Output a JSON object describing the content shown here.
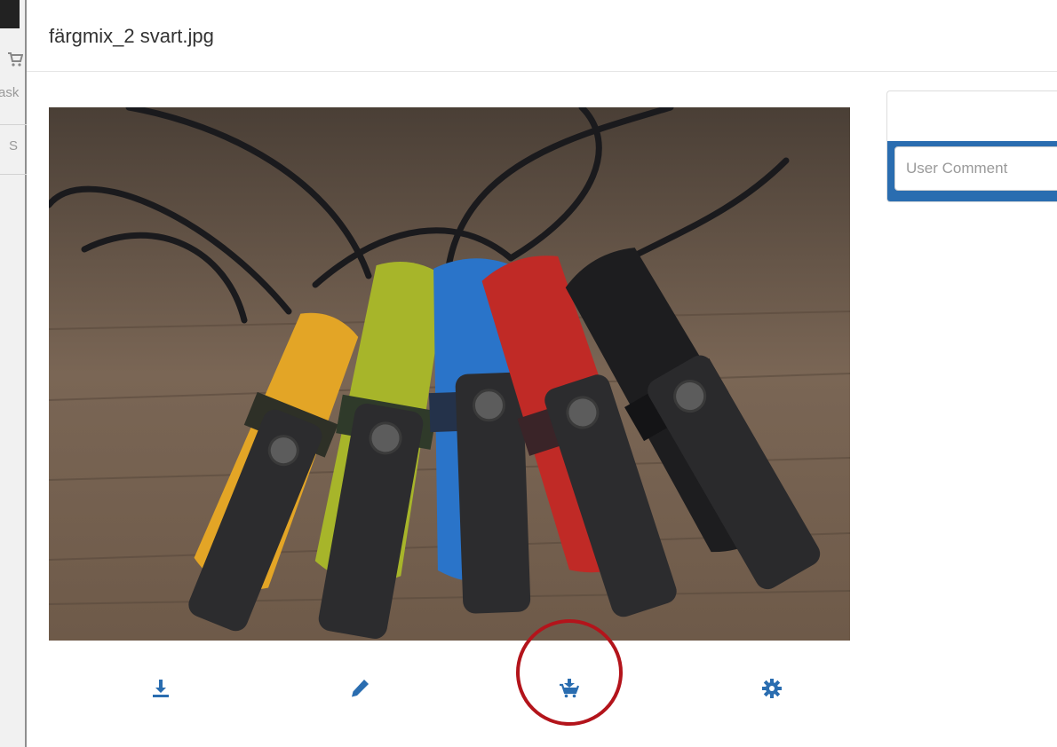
{
  "background_app": {
    "cut_text_1": "ask",
    "cut_text_2": "S"
  },
  "modal": {
    "title": "färgmix_2 svart.jpg"
  },
  "image": {
    "description_name": "knife-photo",
    "sheath_colors": [
      "#e3a526",
      "#a7b52a",
      "#2a74c9",
      "#c02a26",
      "#1d1d1f"
    ]
  },
  "actions": [
    {
      "name": "download-button",
      "icon": "download-icon"
    },
    {
      "name": "edit-button",
      "icon": "pencil-icon"
    },
    {
      "name": "add-to-cart-button",
      "icon": "cart-plus-icon",
      "highlighted": true
    },
    {
      "name": "settings-button",
      "icon": "gear-icon"
    }
  ],
  "side_panel": {
    "comment_placeholder": "User Comment",
    "comment_value": ""
  },
  "colors": {
    "accent": "#2a6db0",
    "icon": "#2a6db0",
    "highlight": "#b3141b"
  }
}
